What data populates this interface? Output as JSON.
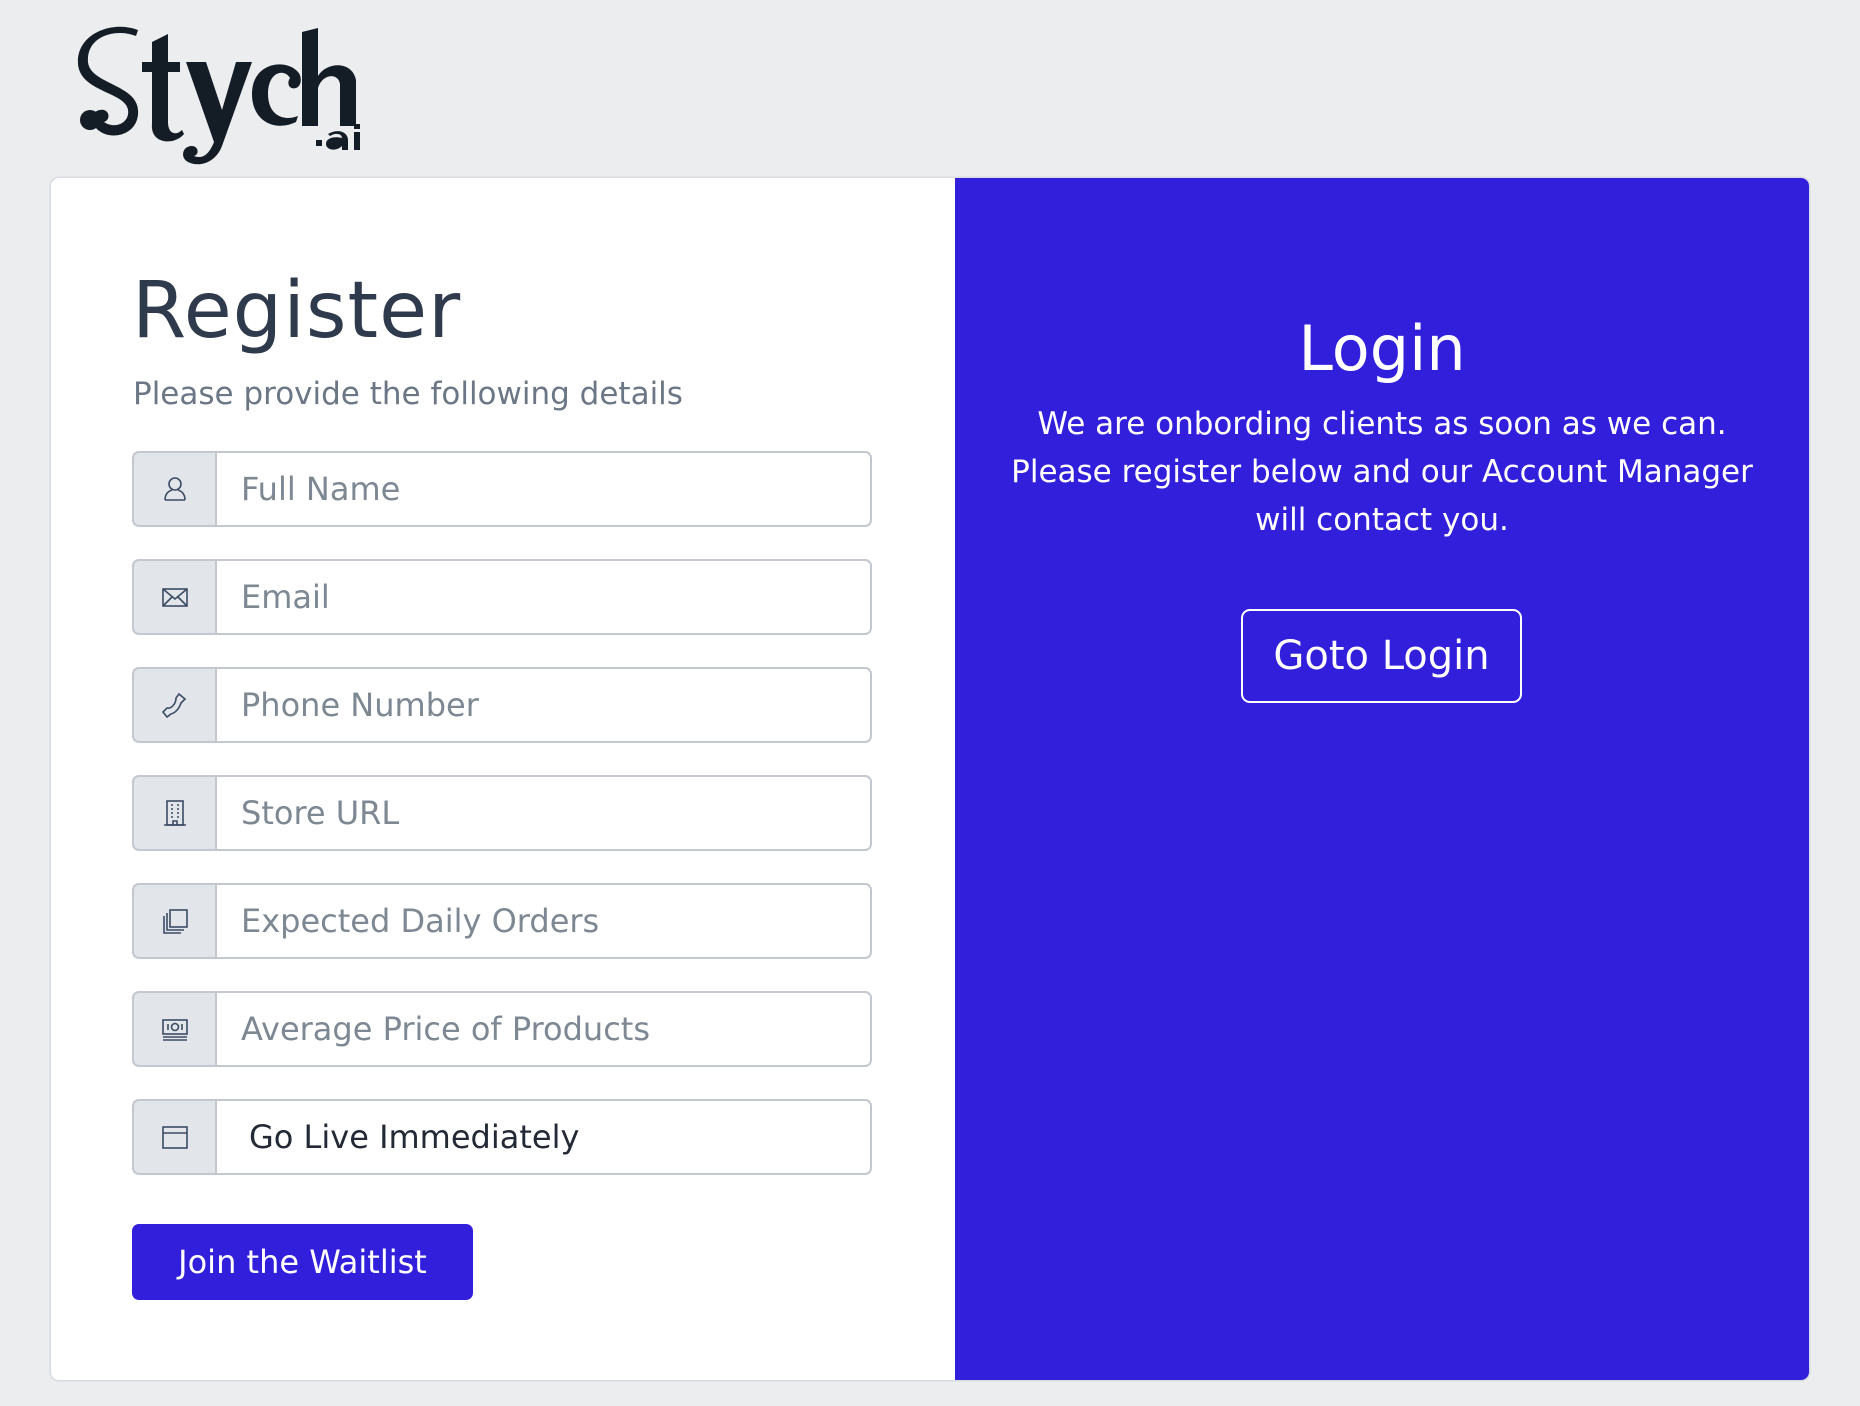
{
  "brand": {
    "logo_text": "Stych.ai"
  },
  "register": {
    "title": "Register",
    "subtitle": "Please provide the following details",
    "fields": [
      {
        "icon": "user-icon",
        "placeholder": "Full Name"
      },
      {
        "icon": "envelope-icon",
        "placeholder": "Email"
      },
      {
        "icon": "phone-icon",
        "placeholder": "Phone Number"
      },
      {
        "icon": "building-icon",
        "placeholder": "Store URL"
      },
      {
        "icon": "layers-icon",
        "placeholder": "Expected Daily Orders"
      },
      {
        "icon": "money-icon",
        "placeholder": "Average Price of Products"
      },
      {
        "icon": "calendar-icon",
        "selected": "Go Live Immediately"
      }
    ],
    "submit_label": "Join the Waitlist"
  },
  "login": {
    "title": "Login",
    "text": "We are onbording clients as soon as we can. Please register below and our Account Manager will contact you.",
    "button_label": "Goto Login"
  },
  "colors": {
    "primary": "#321fdb",
    "page_bg": "#ebedef",
    "text_dark": "#2f3a4c",
    "text_muted": "#6b7785"
  }
}
